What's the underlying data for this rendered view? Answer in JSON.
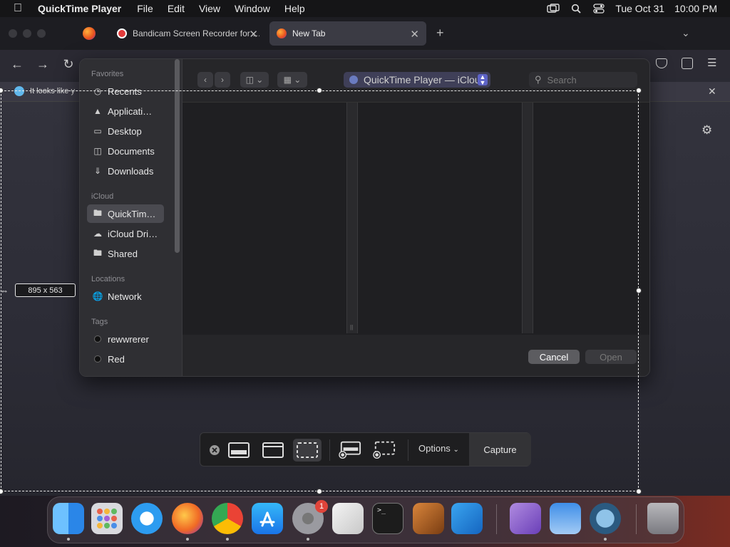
{
  "menubar": {
    "app_name": "QuickTime Player",
    "items": [
      "File",
      "Edit",
      "View",
      "Window",
      "Help"
    ],
    "date": "Tue Oct 31",
    "time": "10:00 PM"
  },
  "browser": {
    "tabs": [
      {
        "label": "Bandicam Screen Recorder for …"
      },
      {
        "label": "New Tab"
      }
    ],
    "notification_text": "It looks like y"
  },
  "dialog": {
    "sidebar": {
      "favorites_header": "Favorites",
      "favorites": [
        "Recents",
        "Applicati…",
        "Desktop",
        "Documents",
        "Downloads"
      ],
      "icloud_header": "iCloud",
      "icloud": [
        "QuickTim…",
        "iCloud Dri…",
        "Shared"
      ],
      "locations_header": "Locations",
      "locations": [
        "Network"
      ],
      "tags_header": "Tags",
      "tags": [
        "rewwrerer",
        "Red"
      ]
    },
    "path": "QuickTime Player — iCloud",
    "search_placeholder": "Search",
    "cancel_label": "Cancel",
    "open_label": "Open"
  },
  "capture": {
    "dimensions": "895  x  563",
    "options_label": "Options",
    "capture_label": "Capture"
  },
  "dock": {
    "badge_count": "1"
  }
}
